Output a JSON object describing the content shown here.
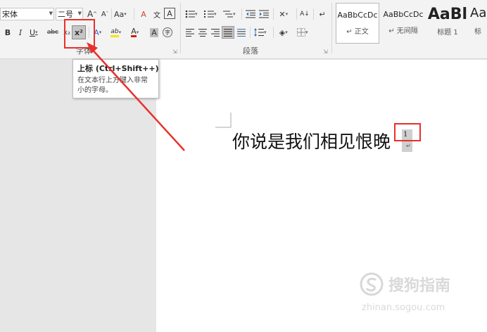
{
  "font_group": {
    "font_name": "宋体",
    "font_size": "二号",
    "grow_label": "A",
    "shrink_label": "A",
    "case_label": "Aa",
    "clear_format_label": "A",
    "phonetic_label": "文",
    "border_char_label": "A",
    "bold_label": "B",
    "italic_label": "I",
    "underline_label": "U",
    "strike_label": "abc",
    "subscript_label": "x₂",
    "superscript_label": "x²",
    "text_effect_label": "A",
    "highlight_label": "ab",
    "font_color_label": "A",
    "char_shading_label": "A",
    "enclose_label": "字",
    "group_label": "字体",
    "launcher": "⇲"
  },
  "paragraph_group": {
    "group_label": "段落",
    "sort_label": "A↓",
    "launcher": "⇲"
  },
  "styles": [
    {
      "sample": "AaBbCcDc",
      "name": "↵ 正文",
      "selected": true
    },
    {
      "sample": "AaBbCcDc",
      "name": "↵ 无间隔",
      "selected": false
    },
    {
      "sample": "AaBl",
      "name": "标题 1",
      "selected": false
    },
    {
      "sample": "Aa",
      "name": "标",
      "selected": false
    }
  ],
  "tooltip": {
    "title": "上标 (Ctrl+Shift++)",
    "description": "在文本行上方键入非常小的字母。"
  },
  "document": {
    "text": "你说是我们相见恨晚",
    "superscript": "1",
    "paragraph_mark": "↵"
  },
  "watermark": {
    "text": "搜狗指南",
    "url": "zhinan.sogou.com"
  },
  "colors": {
    "accent_red": "#e8302b",
    "highlight_yellow": "#f2e600",
    "font_color_red": "#d81e06",
    "text_effect_blue": "#2f6fbf"
  }
}
